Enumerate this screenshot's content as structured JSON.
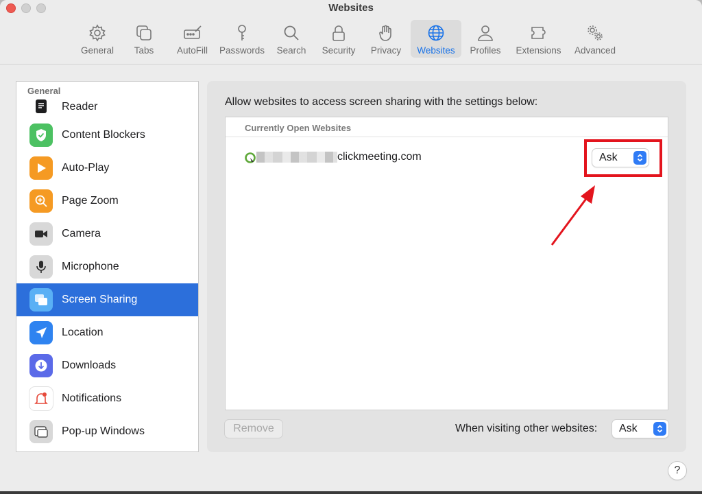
{
  "window": {
    "title": "Websites"
  },
  "toolbar": {
    "tabs": [
      {
        "label": "General",
        "icon": "gear-icon"
      },
      {
        "label": "Tabs",
        "icon": "tabs-icon"
      },
      {
        "label": "AutoFill",
        "icon": "autofill-icon"
      },
      {
        "label": "Passwords",
        "icon": "key-icon"
      },
      {
        "label": "Search",
        "icon": "search-icon"
      },
      {
        "label": "Security",
        "icon": "lock-icon"
      },
      {
        "label": "Privacy",
        "icon": "hand-icon"
      },
      {
        "label": "Websites",
        "icon": "globe-icon",
        "active": true
      },
      {
        "label": "Profiles",
        "icon": "person-icon"
      },
      {
        "label": "Extensions",
        "icon": "puzzle-icon"
      },
      {
        "label": "Advanced",
        "icon": "gears-icon"
      }
    ]
  },
  "sidebar": {
    "header": "General",
    "items": [
      {
        "label": "Reader",
        "icon": "reader-icon"
      },
      {
        "label": "Content Blockers",
        "icon": "shield-check-icon"
      },
      {
        "label": "Auto-Play",
        "icon": "play-icon"
      },
      {
        "label": "Page Zoom",
        "icon": "zoom-icon"
      },
      {
        "label": "Camera",
        "icon": "camera-icon"
      },
      {
        "label": "Microphone",
        "icon": "microphone-icon"
      },
      {
        "label": "Screen Sharing",
        "icon": "screen-sharing-icon",
        "active": true
      },
      {
        "label": "Location",
        "icon": "location-arrow-icon"
      },
      {
        "label": "Downloads",
        "icon": "download-icon"
      },
      {
        "label": "Notifications",
        "icon": "bell-icon"
      },
      {
        "label": "Pop-up Windows",
        "icon": "popup-windows-icon"
      }
    ]
  },
  "main": {
    "description": "Allow websites to access screen sharing with the settings below:",
    "table_header": "Currently Open Websites",
    "sites": [
      {
        "domain": "clickmeeting.com",
        "setting": "Ask"
      }
    ],
    "remove_label": "Remove",
    "other_label": "When visiting other websites:",
    "other_setting": "Ask"
  },
  "help": {
    "label": "?"
  },
  "colors": {
    "accent": "#2c6fdb",
    "highlight": "#e3141d",
    "active_tab_text": "#1a73e8"
  }
}
